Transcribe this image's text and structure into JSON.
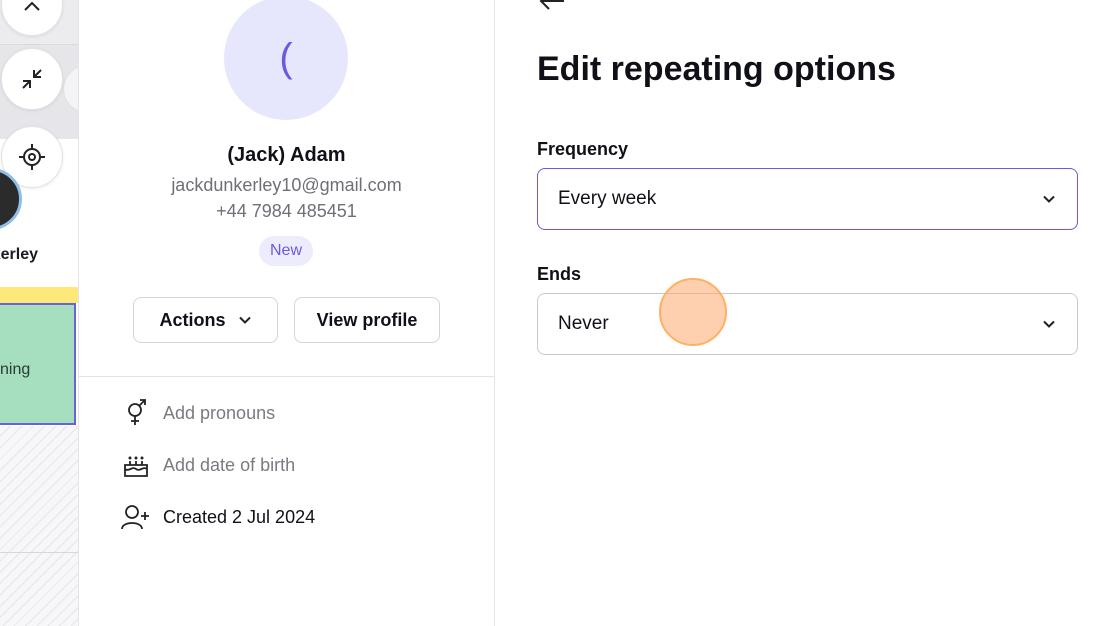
{
  "calendar_strip": {
    "client_name_partial": "kerley",
    "appointment_label_partial": "ning"
  },
  "profile": {
    "avatar_initial": "(",
    "name": "(Jack) Adam",
    "email": "jackdunkerley10@gmail.com",
    "phone": "+44 7984 485451",
    "badge": "New",
    "actions_label": "Actions",
    "view_profile_label": "View profile",
    "add_pronouns": "Add pronouns",
    "add_dob": "Add date of birth",
    "created": "Created 2 Jul 2024"
  },
  "editor": {
    "title": "Edit repeating options",
    "frequency_label": "Frequency",
    "frequency_value": "Every week",
    "ends_label": "Ends",
    "ends_value": "Never"
  },
  "colors": {
    "accent": "#6a5ae0",
    "appointment": "#a5dfbf",
    "highlight": "#ffe87a",
    "cursor": "#ffb060"
  }
}
